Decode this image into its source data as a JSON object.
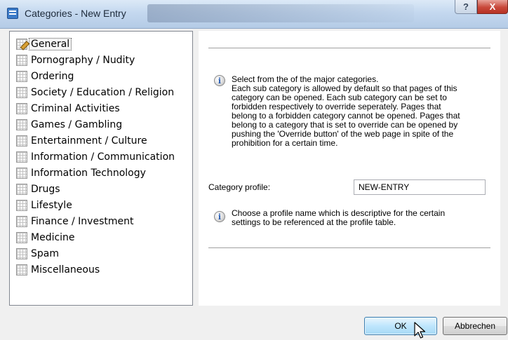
{
  "window": {
    "title": "Categories - New Entry",
    "help_label": "?",
    "close_label": "X"
  },
  "categories": [
    {
      "label": "General",
      "selected": true,
      "icon": "edit-grid-icon"
    },
    {
      "label": "Pornography / Nudity"
    },
    {
      "label": "Ordering"
    },
    {
      "label": "Society / Education / Religion"
    },
    {
      "label": "Criminal Activities"
    },
    {
      "label": "Games / Gambling"
    },
    {
      "label": "Entertainment / Culture"
    },
    {
      "label": "Information / Communication"
    },
    {
      "label": "Information Technology"
    },
    {
      "label": "Drugs"
    },
    {
      "label": "Lifestyle"
    },
    {
      "label": "Finance / Investment"
    },
    {
      "label": "Medicine"
    },
    {
      "label": "Spam"
    },
    {
      "label": "Miscellaneous"
    }
  ],
  "general": {
    "info_text": "Select from the of the major categories.\nEach sub category is allowed by default so that pages of this\ncategory can be opened. Each sub category can be set to\nforbidden respectively to override seperately. Pages that\nbelong to a forbidden category cannot be opened. Pages that\nbelong to a category that is set to override can be opened by\npushing the 'Override button' of the web page in spite of the\nprohibition for a certain time.",
    "profile_label": "Category profile:",
    "profile_value": "NEW-ENTRY",
    "profile_hint": "Choose a profile name which is descriptive for the certain\nsettings to be referenced at the profile table."
  },
  "buttons": {
    "ok": "OK",
    "cancel": "Abbrechen"
  },
  "colors": {
    "accent": "#3c7fb1",
    "close": "#c8483a"
  }
}
